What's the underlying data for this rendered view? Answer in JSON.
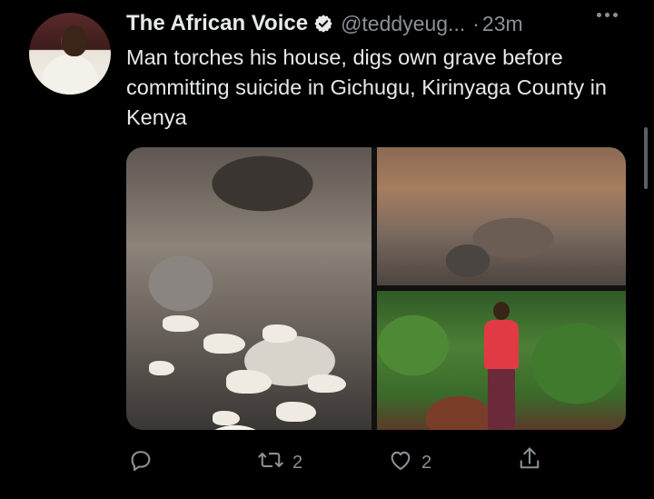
{
  "tweet": {
    "author_name": "The African Voice",
    "handle": "@teddyeug...",
    "separator": "·",
    "time": "23m",
    "text": "Man torches his house, digs own grave before committing suicide in Gichugu, Kirinyaga County in Kenya",
    "retweet_count": "2",
    "like_count": "2"
  },
  "icons": {
    "verified": "verified-badge-icon",
    "more": "more-dots-icon",
    "reply": "reply-icon",
    "retweet": "retweet-icon",
    "like": "heart-icon",
    "share": "share-icon"
  },
  "colors": {
    "background": "#000000",
    "text": "#e7e9ea",
    "secondary": "#8b9096"
  }
}
